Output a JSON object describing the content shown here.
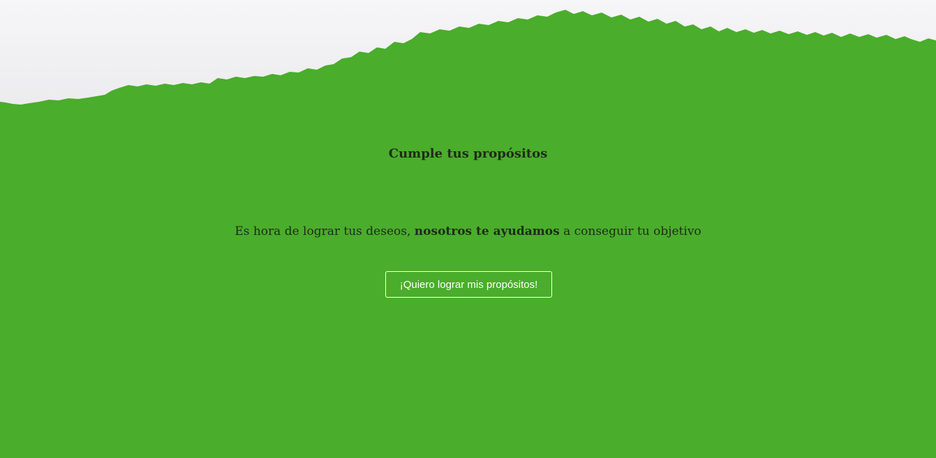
{
  "hero": {
    "title": "Cumple tus propósitos",
    "subtitle_before": "Es hora de lograr tus deseos, ",
    "subtitle_bold": "nosotros te ayudamos",
    "subtitle_after": " a conseguir tu objetivo",
    "cta_label": "¡Quiero lograr mis propósitos!"
  },
  "colors": {
    "background": "#4aad2b",
    "paper": "#f2f1f3",
    "text": "#1f2a1a",
    "button_text": "#ffffff"
  }
}
